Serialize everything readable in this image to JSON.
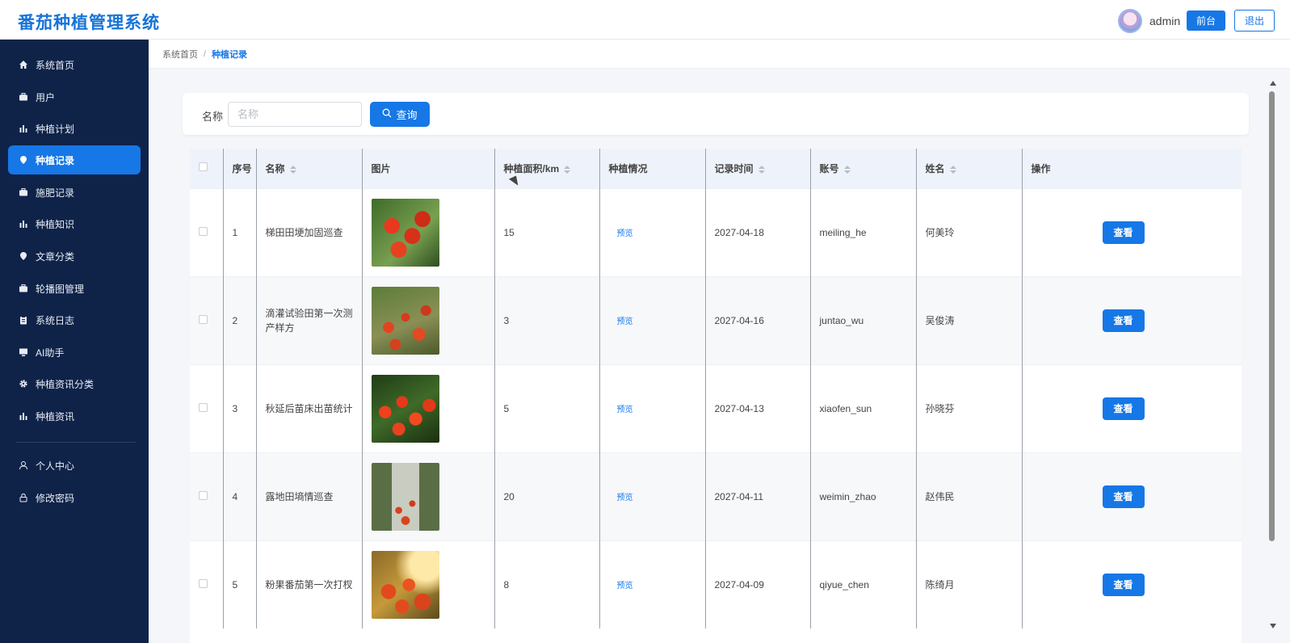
{
  "header": {
    "title": "番茄种植管理系统",
    "username": "admin",
    "front_label": "前台",
    "logout_label": "退出"
  },
  "sidebar": {
    "items": [
      {
        "label": "系统首页",
        "icon": "home-icon"
      },
      {
        "label": "用户",
        "icon": "briefcase-icon"
      },
      {
        "label": "种植计划",
        "icon": "bar-chart-icon"
      },
      {
        "label": "种植记录",
        "icon": "location-pin-icon",
        "active": true
      },
      {
        "label": "施肥记录",
        "icon": "briefcase-icon"
      },
      {
        "label": "种植知识",
        "icon": "bar-chart-icon"
      },
      {
        "label": "文章分类",
        "icon": "location-pin-icon"
      },
      {
        "label": "轮播图管理",
        "icon": "briefcase-icon"
      },
      {
        "label": "系统日志",
        "icon": "clipboard-icon"
      },
      {
        "label": "AI助手",
        "icon": "monitor-icon"
      },
      {
        "label": "种植资讯分类",
        "icon": "gear-icon"
      },
      {
        "label": "种植资讯",
        "icon": "bar-chart-icon"
      }
    ],
    "bottom_items": [
      {
        "label": "个人中心",
        "icon": "user-icon"
      },
      {
        "label": "修改密码",
        "icon": "lock-icon"
      }
    ]
  },
  "breadcrumb": {
    "home": "系统首页",
    "separator": "/",
    "current": "种植记录"
  },
  "search": {
    "label": "名称",
    "placeholder": "名称",
    "value": "",
    "button_label": "查询"
  },
  "table": {
    "headers": {
      "index": "序号",
      "name": "名称",
      "image": "图片",
      "area": "种植面积/km",
      "status": "种植情况",
      "time": "记录时间",
      "account": "账号",
      "person": "姓名",
      "action": "操作"
    },
    "preview_label": "预览",
    "view_label": "查看",
    "rows": [
      {
        "index": "1",
        "name": "梯田田埂加固巡查",
        "area": "15",
        "time": "2027-04-18",
        "account": "meiling_he",
        "person": "何美玲"
      },
      {
        "index": "2",
        "name": "滴灌试验田第一次测产样方",
        "area": "3",
        "time": "2027-04-16",
        "account": "juntao_wu",
        "person": "吴俊涛"
      },
      {
        "index": "3",
        "name": "秋延后苗床出苗统计",
        "area": "5",
        "time": "2027-04-13",
        "account": "xiaofen_sun",
        "person": "孙晓芬"
      },
      {
        "index": "4",
        "name": "露地田墒情巡查",
        "area": "20",
        "time": "2027-04-11",
        "account": "weimin_zhao",
        "person": "赵伟民"
      },
      {
        "index": "5",
        "name": "粉果番茄第一次打杈",
        "area": "8",
        "time": "2027-04-09",
        "account": "qiyue_chen",
        "person": "陈绮月"
      }
    ]
  },
  "colors": {
    "primary": "#1677e6",
    "sidebar_bg": "#0f2349",
    "title": "#1673d8"
  }
}
